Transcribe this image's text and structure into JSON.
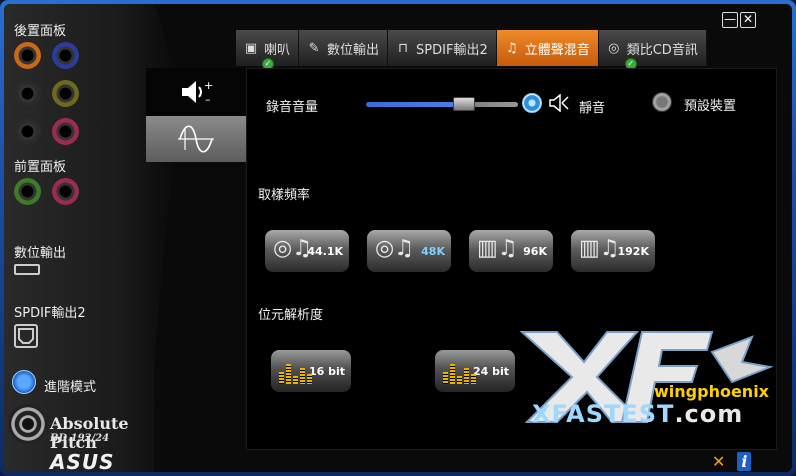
{
  "colors": {
    "accent": "#e07a1c",
    "selected_rate": "#7fd0ff",
    "radio_on": "#2f8ee0",
    "bit_bars": "#e8b400"
  },
  "sidebar": {
    "rear_panel_label": "後置面板",
    "front_panel_label": "前置面板",
    "digital_out_label": "數位輸出",
    "spdif2_label": "SPDIF輸出2",
    "advanced_mode_label": "進階模式",
    "logo_text": "Absolute Pitch",
    "logo_sub": "BD 192/24",
    "brand": "ASUS",
    "rear_jacks": [
      "orange",
      "blue",
      "black",
      "olive",
      "black",
      "pink"
    ],
    "front_jacks": [
      "green",
      "pink"
    ]
  },
  "tabs": [
    {
      "label": "喇叭",
      "icon": "speaker-icon",
      "badge": true,
      "active": false
    },
    {
      "label": "數位輸出",
      "icon": "digital-plug-icon",
      "badge": false,
      "active": false
    },
    {
      "label": "SPDIF輸出2",
      "icon": "spdif-wave-icon",
      "badge": false,
      "active": false
    },
    {
      "label": "立體聲混音",
      "icon": "music-note-icon",
      "badge": false,
      "active": true
    },
    {
      "label": "類比CD音訊",
      "icon": "cd-icon",
      "badge": true,
      "active": false
    }
  ],
  "side_panel": {
    "top_icon": "volume-plus-minus-icon",
    "bottom_icon": "sine-wave-icon"
  },
  "main": {
    "record_volume_label": "錄音音量",
    "record_volume_level": 0.6,
    "mute_label": "靜音",
    "default_device_label": "預設裝置",
    "sample_rate_label": "取樣頻率",
    "sample_rates": [
      "44.1K",
      "48K",
      "96K",
      "192K"
    ],
    "selected_rate": "48K",
    "bit_depth_label": "位元解析度",
    "bit_depths": [
      "16 bit",
      "24 bit"
    ]
  },
  "watermark": {
    "small": "wingphoenix",
    "big_prefix": "XFASTEST",
    "big_suffix": ".com"
  },
  "window": {
    "minimize": "—",
    "close": "✕"
  }
}
